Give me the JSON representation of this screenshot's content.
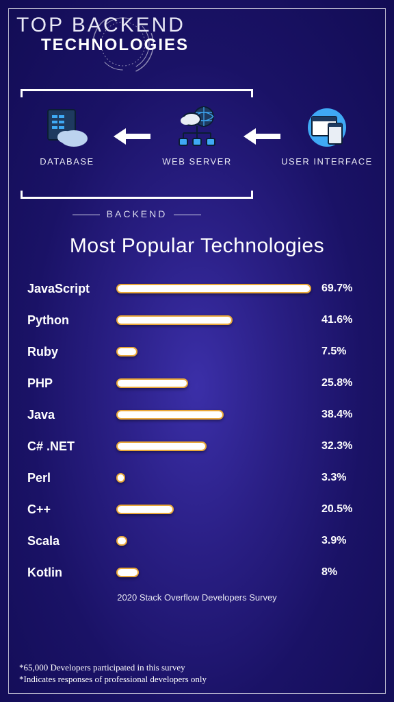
{
  "header": {
    "title_top": "TOP BACKEND",
    "title_bottom": "TECHNOLOGIES"
  },
  "diagram": {
    "nodes": [
      {
        "label": "DATABASE"
      },
      {
        "label": "WEB SERVER"
      },
      {
        "label": "USER INTERFACE"
      }
    ],
    "backend_label": "BACKEND"
  },
  "chart_data": {
    "type": "bar",
    "title": "Most Popular Technologies",
    "categories": [
      "JavaScript",
      "Python",
      "Ruby",
      "PHP",
      "Java",
      "C# .NET",
      "Perl",
      "C++",
      "Scala",
      "Kotlin"
    ],
    "values": [
      69.7,
      41.6,
      7.5,
      25.8,
      38.4,
      32.3,
      3.3,
      20.5,
      3.9,
      8.0
    ],
    "value_suffix": "%",
    "xlim": [
      0,
      70
    ],
    "xlabel": "",
    "ylabel": "",
    "source": "2020 Stack Overflow Developers Survey"
  },
  "footnotes": [
    "*65,000 Developers participated in this survey",
    "*Indicates responses of professional developers only"
  ]
}
